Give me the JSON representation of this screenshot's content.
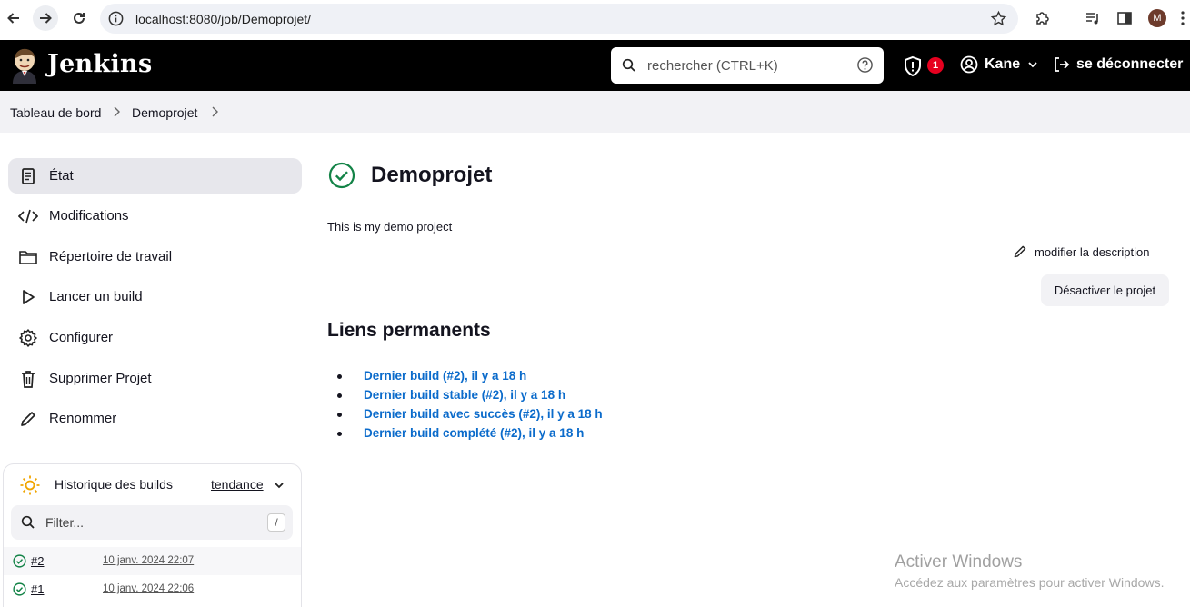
{
  "browser": {
    "url": "localhost:8080/job/Demoprojet/",
    "profile_initial": "M"
  },
  "header": {
    "brand": "Jenkins",
    "search_placeholder": "rechercher (CTRL+K)",
    "security_count": "1",
    "user": "Kane",
    "logout": "se déconnecter"
  },
  "breadcrumb": {
    "items": [
      "Tableau de bord",
      "Demoprojet"
    ]
  },
  "sidebar": {
    "items": [
      {
        "label": "État",
        "icon": "document-icon"
      },
      {
        "label": "Modifications",
        "icon": "code-icon"
      },
      {
        "label": "Répertoire de travail",
        "icon": "folder-icon"
      },
      {
        "label": "Lancer un build",
        "icon": "play-icon"
      },
      {
        "label": "Configurer",
        "icon": "gear-icon"
      },
      {
        "label": "Supprimer Projet",
        "icon": "trash-icon"
      },
      {
        "label": "Renommer",
        "icon": "pencil-icon"
      }
    ]
  },
  "history": {
    "title": "Historique des builds",
    "trend": "tendance",
    "filter_placeholder": "Filter...",
    "filter_shortcut": "/",
    "builds": [
      {
        "number": "#2",
        "date": "10 janv. 2024 22:07"
      },
      {
        "number": "#1",
        "date": "10 janv. 2024 22:06"
      }
    ]
  },
  "main": {
    "title": "Demoprojet",
    "description": "This is my demo project",
    "edit_description": "modifier la description",
    "disable_button": "Désactiver le projet",
    "permalinks_title": "Liens permanents",
    "permalinks": [
      "Dernier build (#2), il y a 18 h",
      "Dernier build stable (#2), il y a 18 h",
      "Dernier build avec succès (#2), il y a 18 h",
      "Dernier build complété (#2), il y a 18 h"
    ]
  },
  "watermark": {
    "title": "Activer Windows",
    "subtitle": "Accédez aux paramètres pour activer Windows."
  },
  "colors": {
    "header_bg": "#000000",
    "link": "#0b6bcb",
    "success": "#138347",
    "badge": "#e6001f"
  }
}
